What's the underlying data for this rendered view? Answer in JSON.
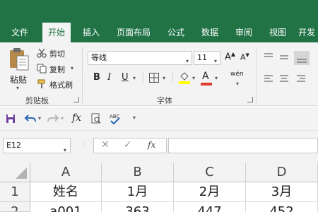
{
  "tabs": [
    {
      "label": "文件",
      "active": false
    },
    {
      "label": "开始",
      "active": true
    },
    {
      "label": "插入",
      "active": false
    },
    {
      "label": "页面布局",
      "active": false
    },
    {
      "label": "公式",
      "active": false
    },
    {
      "label": "数据",
      "active": false
    },
    {
      "label": "审阅",
      "active": false
    },
    {
      "label": "视图",
      "active": false
    },
    {
      "label": "开发",
      "active": false
    }
  ],
  "ribbon": {
    "clipboard": {
      "paste_label": "粘贴",
      "cut_label": "剪切",
      "copy_label": "复制",
      "format_painter_label": "格式刷",
      "group_label": "剪贴板"
    },
    "font": {
      "font_name": "等线",
      "font_size": "11",
      "bold": "B",
      "italic": "I",
      "underline": "U",
      "grow": "A",
      "shrink": "A",
      "font_color_letter": "A",
      "phonetic": "wén",
      "group_label": "字体"
    }
  },
  "formula_bar": {
    "name_box": "E12",
    "fx": "fx",
    "content": ""
  },
  "sheet": {
    "columns": [
      "A",
      "B",
      "C",
      "D"
    ],
    "rows": [
      {
        "num": "1",
        "cells": [
          "姓名",
          "1月",
          "2月",
          "3月"
        ]
      },
      {
        "num": "2",
        "cells": [
          "a001",
          "363",
          "447",
          "452"
        ]
      }
    ]
  },
  "colors": {
    "accent": "#217346",
    "ribbon_bg": "#f3f3f3",
    "highlight_yellow": "#ffff00",
    "font_red": "#e03a2f",
    "undo_blue": "#2b66b1"
  }
}
